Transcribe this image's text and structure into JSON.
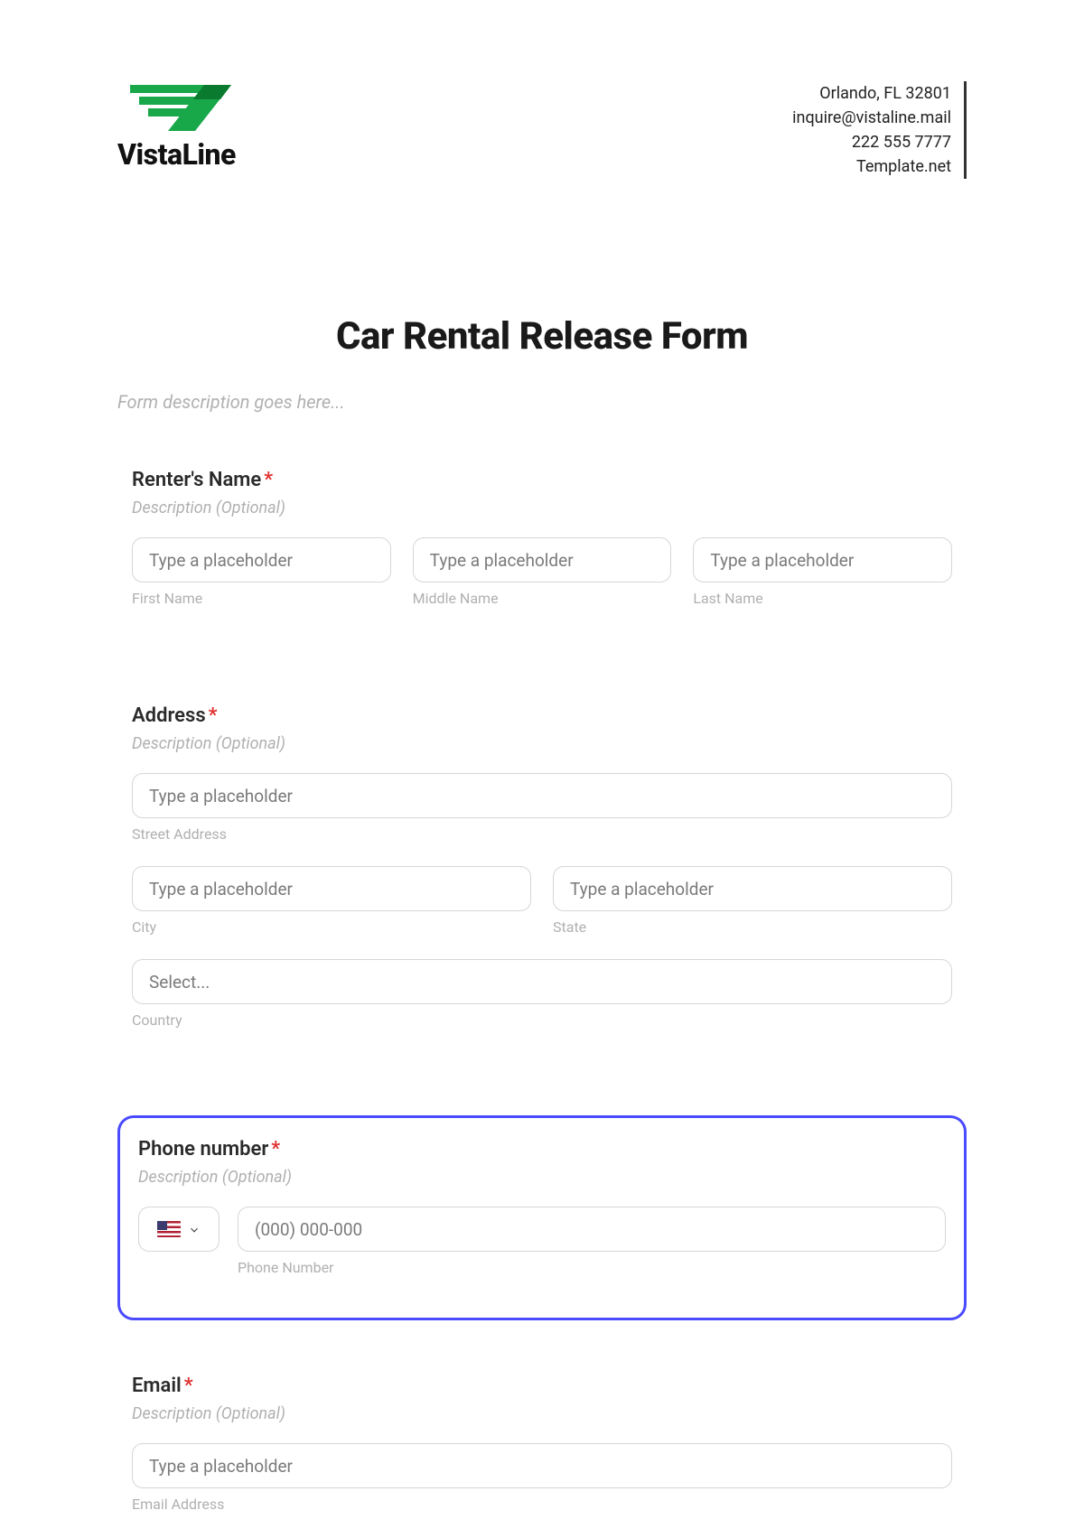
{
  "brand": {
    "name": "VistaLine"
  },
  "contact": {
    "line1": "Orlando, FL 32801",
    "line2": "inquire@vistaline.mail",
    "line3": "222 555 7777",
    "line4": "Template.net"
  },
  "form": {
    "title": "Car Rental Release Form",
    "description_placeholder": "Form description goes here..."
  },
  "sections": {
    "name": {
      "label": "Renter's Name",
      "required_mark": "*",
      "sub_placeholder": "Description (Optional)",
      "first": {
        "placeholder": "Type a placeholder",
        "sublabel": "First Name"
      },
      "middle": {
        "placeholder": "Type a placeholder",
        "sublabel": "Middle Name"
      },
      "last": {
        "placeholder": "Type a placeholder",
        "sublabel": "Last Name"
      }
    },
    "address": {
      "label": "Address",
      "required_mark": "*",
      "sub_placeholder": "Description (Optional)",
      "street": {
        "placeholder": "Type a placeholder",
        "sublabel": "Street Address"
      },
      "city": {
        "placeholder": "Type a placeholder",
        "sublabel": "City"
      },
      "state": {
        "placeholder": "Type a placeholder",
        "sublabel": "State"
      },
      "country": {
        "placeholder": "Select...",
        "sublabel": "Country"
      }
    },
    "phone": {
      "label": "Phone number",
      "required_mark": "*",
      "sub_placeholder": "Description (Optional)",
      "number": {
        "placeholder": "(000) 000-000",
        "sublabel": "Phone Number"
      }
    },
    "email": {
      "label": "Email",
      "required_mark": "*",
      "sub_placeholder": "Description (Optional)",
      "field": {
        "placeholder": "Type a placeholder",
        "sublabel": "Email Address"
      }
    }
  }
}
